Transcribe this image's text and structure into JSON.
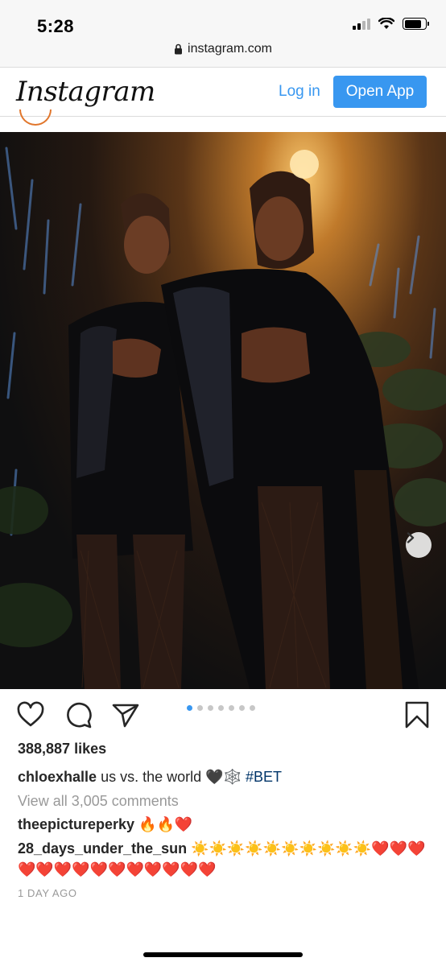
{
  "status_bar": {
    "time": "5:28"
  },
  "browser": {
    "url": "instagram.com",
    "lock_icon": "lock-icon"
  },
  "header": {
    "logo": "Instagram",
    "login": "Log in",
    "open_app": "Open App"
  },
  "post": {
    "likes": "388,887 likes",
    "carousel": {
      "count": 7,
      "active_index": 0
    },
    "caption": {
      "user": "chloexhalle",
      "text": "us vs. the world",
      "emojis": "🖤🕸️",
      "tag": "#BET"
    },
    "view_comments": "View all 3,005 comments",
    "comments": [
      {
        "user": "theepictureperky",
        "text": "🔥🔥❤️"
      },
      {
        "user": "28_days_under_the_sun",
        "text": "☀️☀️☀️☀️☀️☀️☀️☀️☀️☀️❤️❤️❤️❤️❤️❤️❤️❤️❤️❤️❤️❤️❤️❤️"
      }
    ],
    "timestamp": "1 DAY AGO"
  },
  "colors": {
    "accent": "#3897f0",
    "hashtag": "#003569",
    "muted": "#999999"
  },
  "icons": [
    "heart-icon",
    "comment-icon",
    "share-icon",
    "bookmark-icon",
    "chevron-right-icon",
    "wifi-icon",
    "signal-icon",
    "battery-icon"
  ]
}
